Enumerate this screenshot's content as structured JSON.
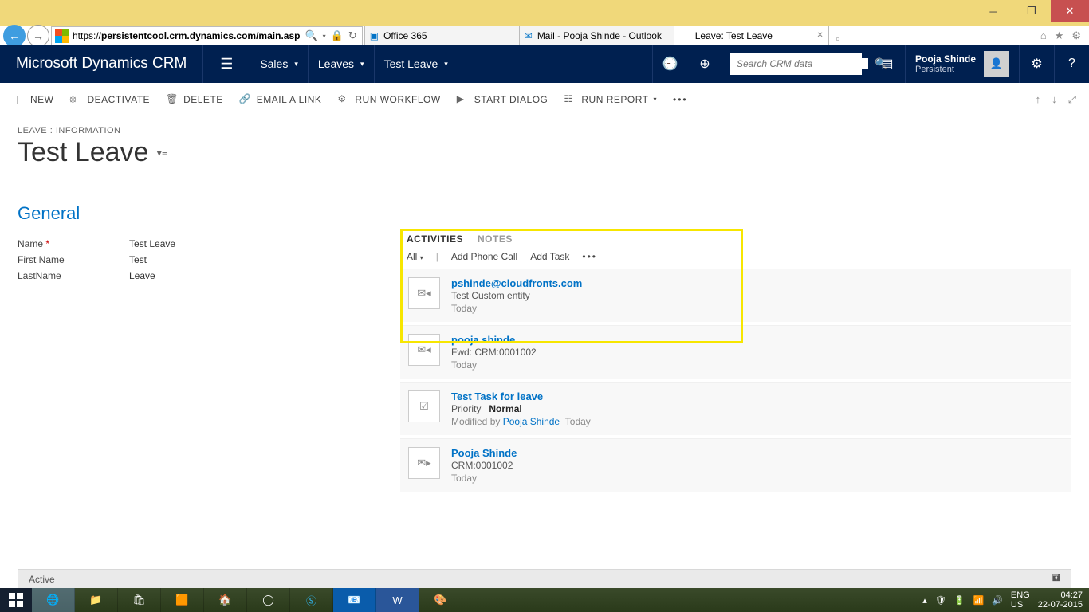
{
  "window": {
    "ie_url": "persistentcool.crm.dynamics.com/main.asp"
  },
  "ie_tabs": [
    {
      "label": "Office 365"
    },
    {
      "label": "Mail - Pooja Shinde - Outlook"
    },
    {
      "label": "Leave: Test Leave"
    }
  ],
  "crm": {
    "logo": "Microsoft Dynamics CRM",
    "breadcrumb": [
      "Sales",
      "Leaves",
      "Test Leave"
    ],
    "search_placeholder": "Search CRM data",
    "user": {
      "name": "Pooja Shinde",
      "org": "Persistent"
    }
  },
  "commands": {
    "new": "NEW",
    "deactivate": "DEACTIVATE",
    "delete": "DELETE",
    "email": "EMAIL A LINK",
    "workflow": "RUN WORKFLOW",
    "dialog": "START DIALOG",
    "report": "RUN REPORT"
  },
  "record": {
    "entity_label": "LEAVE : INFORMATION",
    "title": "Test Leave",
    "section": "General",
    "fields": {
      "name_label": "Name",
      "name_value": "Test Leave",
      "first_label": "First Name",
      "first_value": "Test",
      "last_label": "LastName",
      "last_value": "Leave"
    },
    "status": "Active"
  },
  "activities": {
    "tab_activities": "ACTIVITIES",
    "tab_notes": "NOTES",
    "filter_all": "All",
    "add_phone": "Add Phone Call",
    "add_task": "Add Task",
    "items": [
      {
        "title": "pshinde@cloudfronts.com",
        "subject": "Test Custom entity",
        "time": "Today"
      },
      {
        "title": "pooja shinde",
        "subject": "Fwd: CRM:0001002",
        "time": "Today"
      },
      {
        "title": "Test Task for leave",
        "priority_label": "Priority",
        "priority_value": "Normal",
        "modified_label": "Modified by",
        "modified_by": "Pooja Shinde",
        "modified_time": "Today"
      },
      {
        "title": "Pooja Shinde",
        "subject": "CRM:0001002",
        "time": "Today"
      }
    ]
  },
  "taskbar": {
    "lang1": "ENG",
    "lang2": "US",
    "time": "04:27",
    "date": "22-07-2015"
  }
}
